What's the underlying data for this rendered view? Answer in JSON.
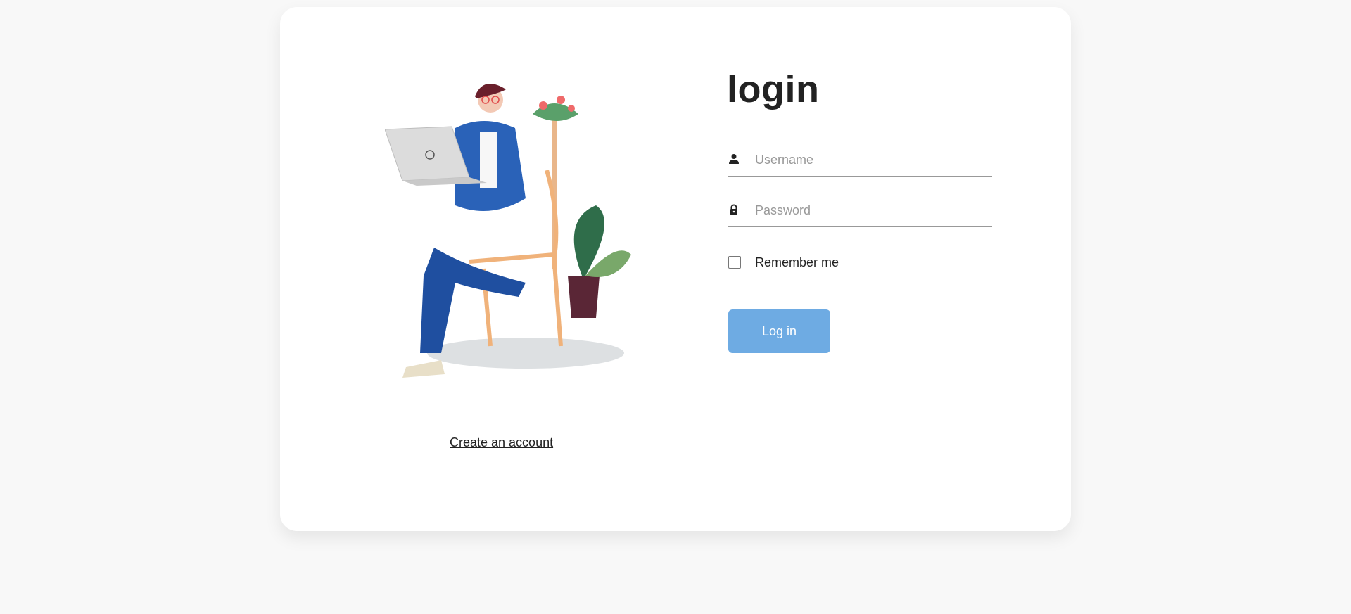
{
  "login": {
    "title": "login",
    "username": {
      "placeholder": "Username",
      "value": "",
      "icon": "user-icon"
    },
    "password": {
      "placeholder": "Password",
      "value": "",
      "icon": "lock-icon"
    },
    "remember_label": "Remember me",
    "remember_checked": false,
    "submit_label": "Log in",
    "create_account_label": "Create an account"
  },
  "colors": {
    "button": "#6eabe3",
    "background": "#f8f8f8",
    "card": "#ffffff"
  }
}
